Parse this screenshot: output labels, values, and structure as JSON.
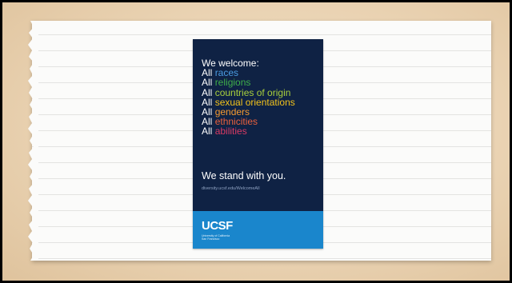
{
  "slide": {
    "poster": {
      "heading": "We welcome:",
      "lines": [
        {
          "prefix": "All",
          "word": "races",
          "color": "#4a9be0"
        },
        {
          "prefix": "All",
          "word": "religions",
          "color": "#3fae49"
        },
        {
          "prefix": "All",
          "word": "countries of origin",
          "color": "#a9cf3c"
        },
        {
          "prefix": "All",
          "word": "sexual orientations",
          "color": "#f2c21b"
        },
        {
          "prefix": "All",
          "word": "genders",
          "color": "#f59a2f"
        },
        {
          "prefix": "All",
          "word": "ethnicities",
          "color": "#e8603c"
        },
        {
          "prefix": "All",
          "word": "abilities",
          "color": "#d83a63"
        }
      ],
      "stand": "We stand with you.",
      "url": "diversity.ucsf.edu/WelcomeAll",
      "logo": "UCSF",
      "logo_sub_1": "University of California",
      "logo_sub_2": "San Francisco",
      "colors": {
        "poster_bg": "#0f2244",
        "band": "#1a86cc"
      }
    }
  }
}
